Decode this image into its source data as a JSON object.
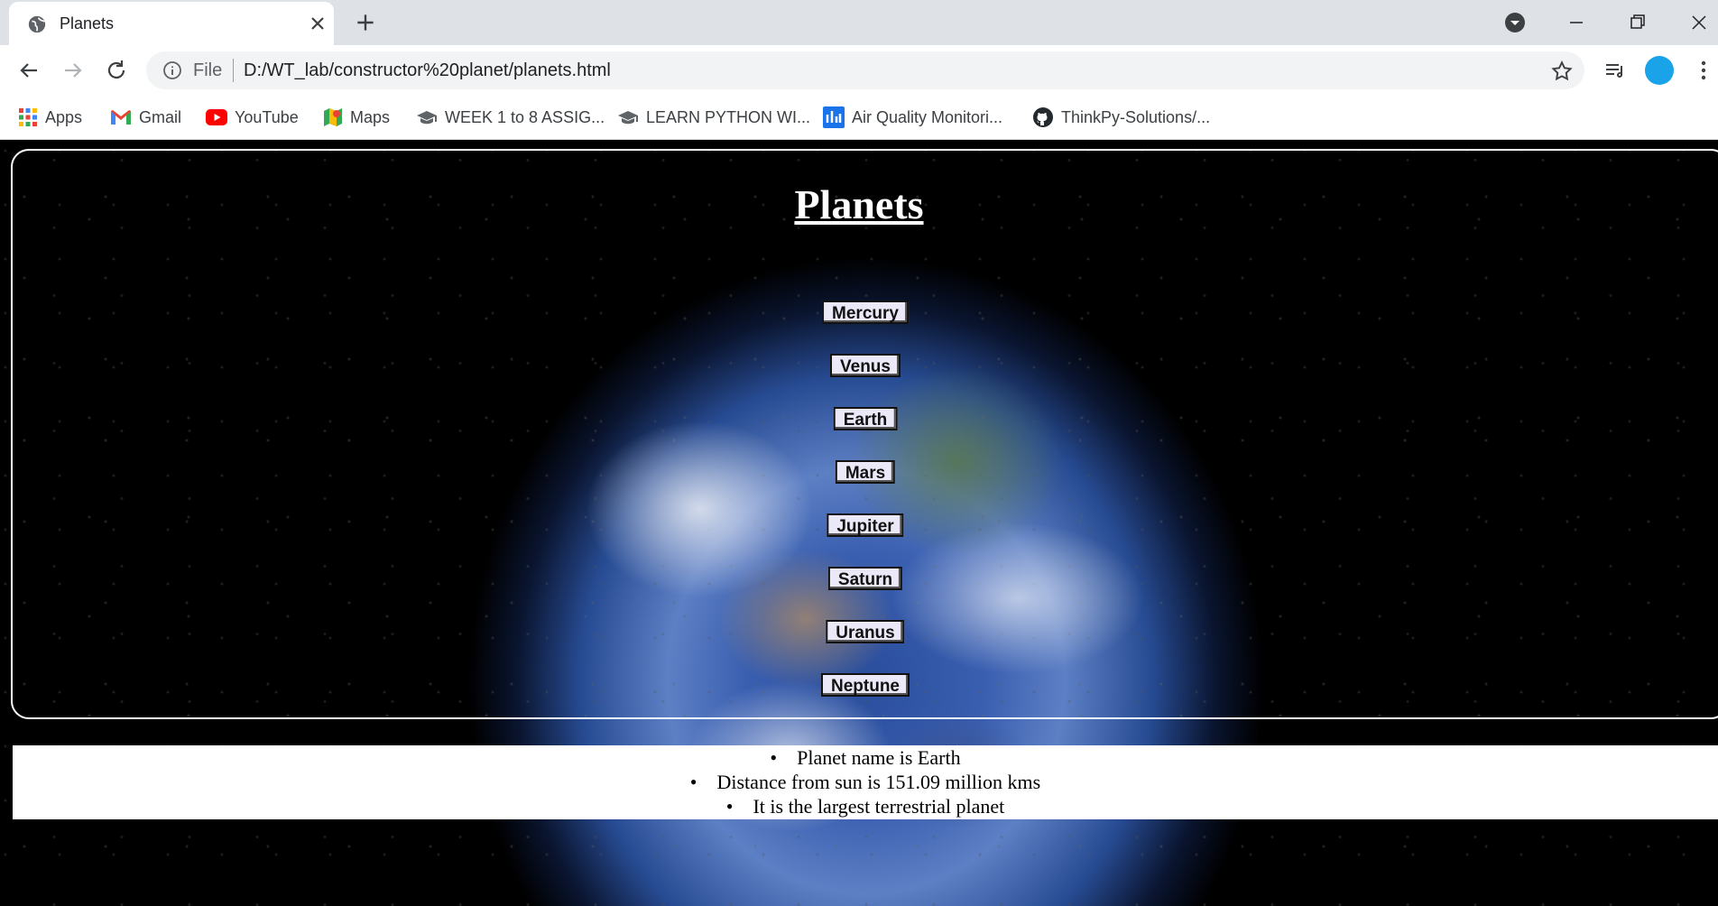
{
  "browser": {
    "tab_title": "Planets",
    "file_label": "File",
    "url": "D:/WT_lab/constructor%20planet/planets.html",
    "bookmarks": [
      {
        "label": "Apps",
        "icon": "apps-grid-icon"
      },
      {
        "label": "Gmail",
        "icon": "gmail-icon"
      },
      {
        "label": "YouTube",
        "icon": "youtube-icon"
      },
      {
        "label": "Maps",
        "icon": "maps-icon"
      },
      {
        "label": "WEEK 1 to 8 ASSIG...",
        "icon": "graduation-cap-icon"
      },
      {
        "label": "LEARN PYTHON WI...",
        "icon": "graduation-cap-icon"
      },
      {
        "label": "Air Quality Monitori...",
        "icon": "chart-icon"
      },
      {
        "label": "ThinkPy-Solutions/...",
        "icon": "github-icon"
      }
    ],
    "avatar_color": "#1aa3e8"
  },
  "page": {
    "title": "Planets",
    "planets": [
      "Mercury",
      "Venus",
      "Earth",
      "Mars",
      "Jupiter",
      "Saturn",
      "Uranus",
      "Neptune"
    ],
    "info": [
      "Planet name is Earth",
      "Distance from sun is 151.09 million kms",
      "It is the largest terrestrial planet"
    ]
  }
}
